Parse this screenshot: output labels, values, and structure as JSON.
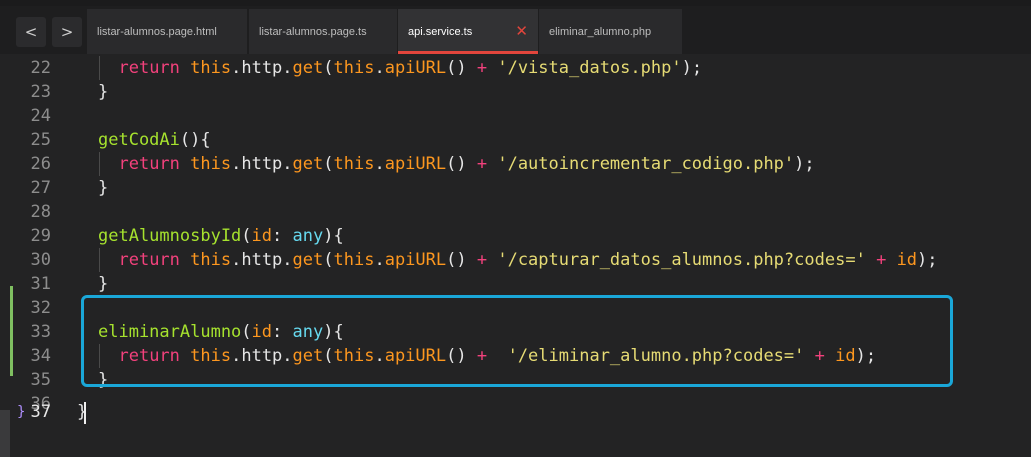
{
  "tabs": [
    {
      "label": "listar-alumnos.page.html",
      "active": false
    },
    {
      "label": "listar-alumnos.page.ts",
      "active": false
    },
    {
      "label": "api.service.ts",
      "active": true
    },
    {
      "label": "eliminar_alumno.php",
      "active": false
    }
  ],
  "nav": {
    "back": "<",
    "forward": ">"
  },
  "close_glyph": "✕",
  "line_numbers": [
    "22",
    "23",
    "24",
    "25",
    "26",
    "27",
    "28",
    "29",
    "30",
    "31",
    "32",
    "33",
    "34",
    "35",
    "36",
    "37"
  ],
  "current_line": "37",
  "fold_glyph": "}",
  "code": {
    "l22_indent": "  ",
    "l22_kw": "return",
    "l22_sp": " ",
    "l22_this": "this",
    "l22_dot1": ".http.",
    "l22_get": "get",
    "l22_p1": "(",
    "l22_this2": "this",
    "l22_dot2": ".",
    "l22_api": "apiURL",
    "l22_p2": "() ",
    "l22_plus": "+",
    "l22_sp2": " ",
    "l22_str": "'/vista_datos.php'",
    "l22_end": ");",
    "l23": "}",
    "l25_fn": "getCodAi",
    "l25_rest": "(){",
    "l26_indent": "  ",
    "l26_kw": "return",
    "l26_sp": " ",
    "l26_this": "this",
    "l26_dot1": ".http.",
    "l26_get": "get",
    "l26_p1": "(",
    "l26_this2": "this",
    "l26_dot2": ".",
    "l26_api": "apiURL",
    "l26_p2": "() ",
    "l26_plus": "+",
    "l26_sp2": " ",
    "l26_str": "'/autoincrementar_codigo.php'",
    "l26_end": ");",
    "l27": "}",
    "l29_fn": "getAlumnosbyId",
    "l29_p": "(",
    "l29_param": "id",
    "l29_colon": ": ",
    "l29_type": "any",
    "l29_rest": "){",
    "l30_indent": "  ",
    "l30_kw": "return",
    "l30_sp": " ",
    "l30_this": "this",
    "l30_dot1": ".http.",
    "l30_get": "get",
    "l30_p1": "(",
    "l30_this2": "this",
    "l30_dot2": ".",
    "l30_api": "apiURL",
    "l30_p2": "() ",
    "l30_plus": "+",
    "l30_sp2": " ",
    "l30_str": "'/capturar_datos_alumnos.php?codes='",
    "l30_sp3": " ",
    "l30_plus2": "+",
    "l30_sp4": " ",
    "l30_param": "id",
    "l30_end": ");",
    "l31": "}",
    "l33_fn": "eliminarAlumno",
    "l33_p": "(",
    "l33_param": "id",
    "l33_colon": ": ",
    "l33_type": "any",
    "l33_rest": "){",
    "l34_indent": "  ",
    "l34_kw": "return",
    "l34_sp": " ",
    "l34_this": "this",
    "l34_dot1": ".http.",
    "l34_get": "get",
    "l34_p1": "(",
    "l34_this2": "this",
    "l34_dot2": ".",
    "l34_api": "apiURL",
    "l34_p2": "() ",
    "l34_plus": "+",
    "l34_sp2": "  ",
    "l34_str": "'/eliminar_alumno.php?codes='",
    "l34_sp3": " ",
    "l34_plus2": "+",
    "l34_sp4": " ",
    "l34_param": "id",
    "l34_end": ");",
    "l35": "}",
    "l37": "}"
  },
  "colors": {
    "keyword": "#f2417c",
    "this": "#fd971f",
    "function": "#a6e22e",
    "string": "#e6db74",
    "type": "#66d9ef",
    "highlight_border": "#1aa7d8",
    "tab_close": "#e2453c",
    "modified_marker": "#7fbf61"
  },
  "icons": {
    "close": "close-icon",
    "back": "chevron-left-icon",
    "forward": "chevron-right-icon"
  }
}
